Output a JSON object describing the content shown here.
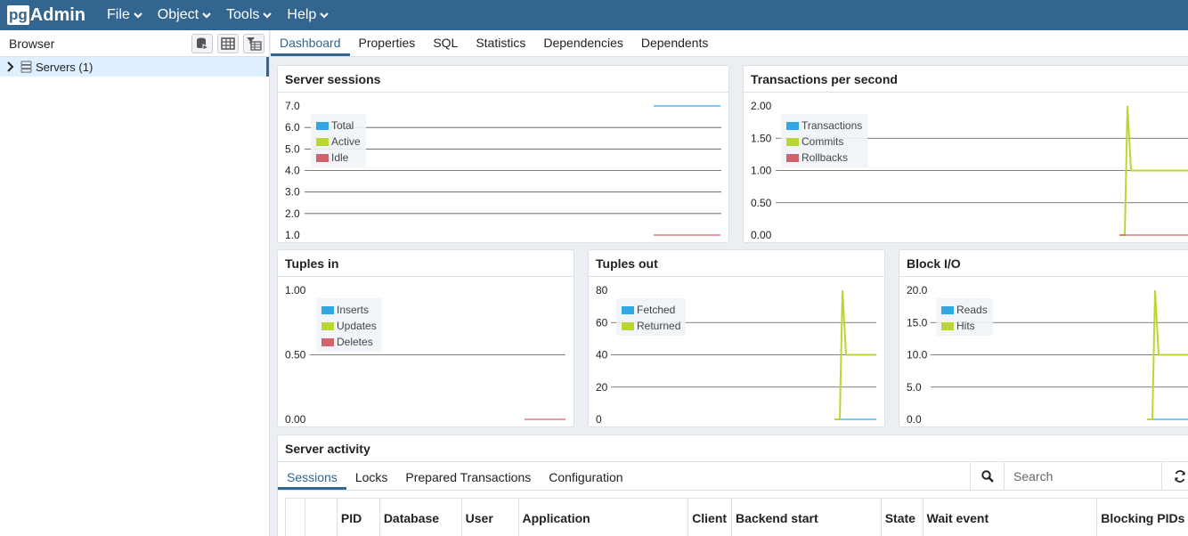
{
  "app": {
    "logo_pg": "pg",
    "logo_admin": "Admin"
  },
  "menu": [
    {
      "label": "File"
    },
    {
      "label": "Object"
    },
    {
      "label": "Tools"
    },
    {
      "label": "Help"
    }
  ],
  "browser": {
    "title": "Browser",
    "tree": [
      {
        "label": "Servers (1)"
      }
    ]
  },
  "main_tabs": [
    {
      "label": "Dashboard",
      "active": true
    },
    {
      "label": "Properties"
    },
    {
      "label": "SQL"
    },
    {
      "label": "Statistics"
    },
    {
      "label": "Dependencies"
    },
    {
      "label": "Dependents"
    }
  ],
  "colors": {
    "blue": "#2fa8e3",
    "green": "#bcd631",
    "red": "#d0646c",
    "brand": "#326690"
  },
  "cards": {
    "server_sessions": {
      "title": "Server sessions"
    },
    "tps": {
      "title": "Transactions per second"
    },
    "tuples_in": {
      "title": "Tuples in"
    },
    "tuples_out": {
      "title": "Tuples out"
    },
    "block_io": {
      "title": "Block I/O"
    }
  },
  "chart_data": [
    {
      "type": "line",
      "title": "Server sessions",
      "ylim": [
        1.0,
        7.0
      ],
      "yticks": [
        "7.0",
        "6.0",
        "5.0",
        "4.0",
        "3.0",
        "2.0",
        "1.0"
      ],
      "series": [
        {
          "name": "Total",
          "color": "#2fa8e3",
          "values": [
            7,
            7
          ]
        },
        {
          "name": "Active",
          "color": "#bcd631",
          "values": []
        },
        {
          "name": "Idle",
          "color": "#d0646c",
          "values": [
            1,
            1
          ]
        }
      ]
    },
    {
      "type": "line",
      "title": "Transactions per second",
      "ylim": [
        0,
        2.0
      ],
      "yticks": [
        "2.00",
        "1.50",
        "1.00",
        "0.50",
        "0.00"
      ],
      "series": [
        {
          "name": "Transactions",
          "color": "#2fa8e3",
          "values": []
        },
        {
          "name": "Commits",
          "color": "#bcd631",
          "values": [
            0,
            2,
            1,
            1,
            1
          ]
        },
        {
          "name": "Rollbacks",
          "color": "#d0646c",
          "values": [
            0,
            0
          ]
        }
      ]
    },
    {
      "type": "line",
      "title": "Tuples in",
      "ylim": [
        0,
        1.0
      ],
      "yticks": [
        "1.00",
        "0.50",
        "0.00"
      ],
      "series": [
        {
          "name": "Inserts",
          "color": "#2fa8e3",
          "values": []
        },
        {
          "name": "Updates",
          "color": "#bcd631",
          "values": []
        },
        {
          "name": "Deletes",
          "color": "#d0646c",
          "values": [
            0,
            0
          ]
        }
      ]
    },
    {
      "type": "line",
      "title": "Tuples out",
      "ylim": [
        0,
        80
      ],
      "yticks": [
        "80",
        "60",
        "40",
        "20",
        "0"
      ],
      "series": [
        {
          "name": "Fetched",
          "color": "#2fa8e3",
          "values": [
            0,
            0
          ]
        },
        {
          "name": "Returned",
          "color": "#bcd631",
          "values": [
            0,
            80,
            40,
            40,
            40
          ]
        }
      ]
    },
    {
      "type": "line",
      "title": "Block I/O",
      "ylim": [
        0,
        20
      ],
      "yticks": [
        "20.0",
        "15.0",
        "10.0",
        "5.0",
        "0.0"
      ],
      "series": [
        {
          "name": "Reads",
          "color": "#2fa8e3",
          "values": [
            0,
            0
          ]
        },
        {
          "name": "Hits",
          "color": "#bcd631",
          "values": [
            0,
            20,
            10,
            10,
            10
          ]
        }
      ]
    }
  ],
  "activity": {
    "title": "Server activity",
    "tabs": [
      {
        "label": "Sessions",
        "active": true
      },
      {
        "label": "Locks"
      },
      {
        "label": "Prepared Transactions"
      },
      {
        "label": "Configuration"
      }
    ],
    "search_placeholder": "Search",
    "columns": [
      "",
      "",
      "PID",
      "Database",
      "User",
      "Application",
      "Client",
      "Backend start",
      "State",
      "Wait event",
      "Blocking PIDs"
    ]
  }
}
